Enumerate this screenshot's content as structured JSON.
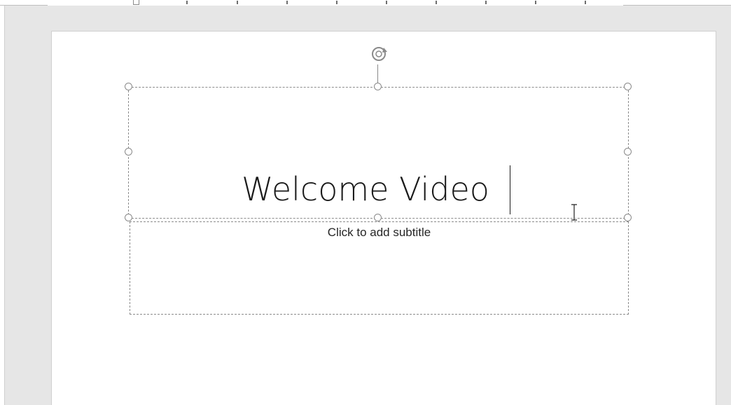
{
  "slide": {
    "title": "Welcome Video",
    "subtitle_placeholder": "Click to add subtitle"
  },
  "selection": {
    "handles": [
      "top-left",
      "top-center",
      "top-right",
      "middle-left",
      "middle-right",
      "bottom-left",
      "bottom-center",
      "bottom-right"
    ],
    "rotate_icon": "rotate-icon"
  },
  "cursor": {
    "icon": "text-cursor-icon"
  },
  "colors": {
    "workspace": "#e6e6e6",
    "slide": "#ffffff",
    "handle_stroke": "#8a8a8a",
    "text": "#1a1a1a"
  }
}
